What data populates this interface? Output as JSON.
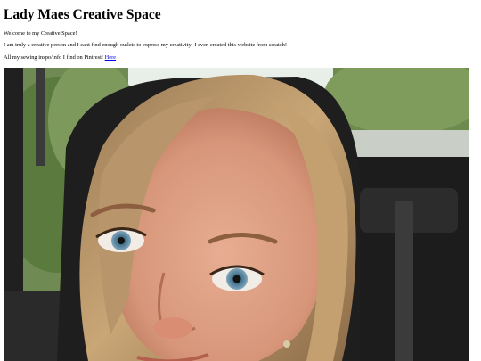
{
  "page": {
    "title": "Lady Maes Creative Space",
    "welcome": "Welcome to my Creative Space!",
    "intro": "I am truly a creative person and I cant find enough outlets to express my creativity! I even created this website from scratch!",
    "inspo_text": "All my sewing inspo/info I find on Pintrest!",
    "inspo_link": "Here"
  },
  "colors": {
    "link": "#0000ee",
    "text": "#000000",
    "background": "#ffffff"
  }
}
